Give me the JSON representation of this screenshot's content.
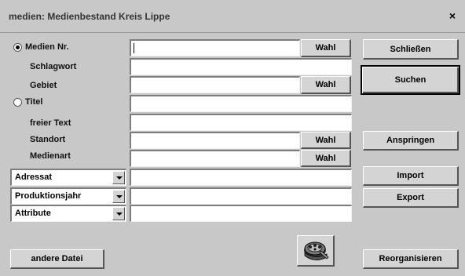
{
  "window": {
    "title": "medien:  Medienbestand Kreis Lippe",
    "close_label": "×"
  },
  "search": {
    "radio_medien_nr": "Medien Nr.",
    "label_schlagwort": "Schlagwort",
    "label_gebiet": "Gebiet",
    "radio_titel": "Titel",
    "label_freier_text": "freier Text",
    "label_standort": "Standort",
    "label_medienart": "Medienart",
    "selected_mode": "Medien Nr.",
    "fields": {
      "medien_nr": "",
      "schlagwort": "",
      "gebiet": "",
      "titel": "",
      "freier_text": "",
      "standort": "",
      "medienart": "",
      "adressat": "",
      "produktionsjahr": "",
      "attribute": ""
    }
  },
  "combos": {
    "adressat": "Adressat",
    "produktionsjahr": "Produktionsjahr",
    "attribute": "Attribute"
  },
  "buttons": {
    "wahl": "Wahl",
    "schliessen": "Schließen",
    "suchen": "Suchen",
    "anspringen": "Anspringen",
    "import": "Import",
    "export": "Export",
    "andere_datei": "andere Datei",
    "reorganisieren": "Reorganisieren"
  },
  "icons": {
    "film_reel": "film-reel-icon"
  }
}
